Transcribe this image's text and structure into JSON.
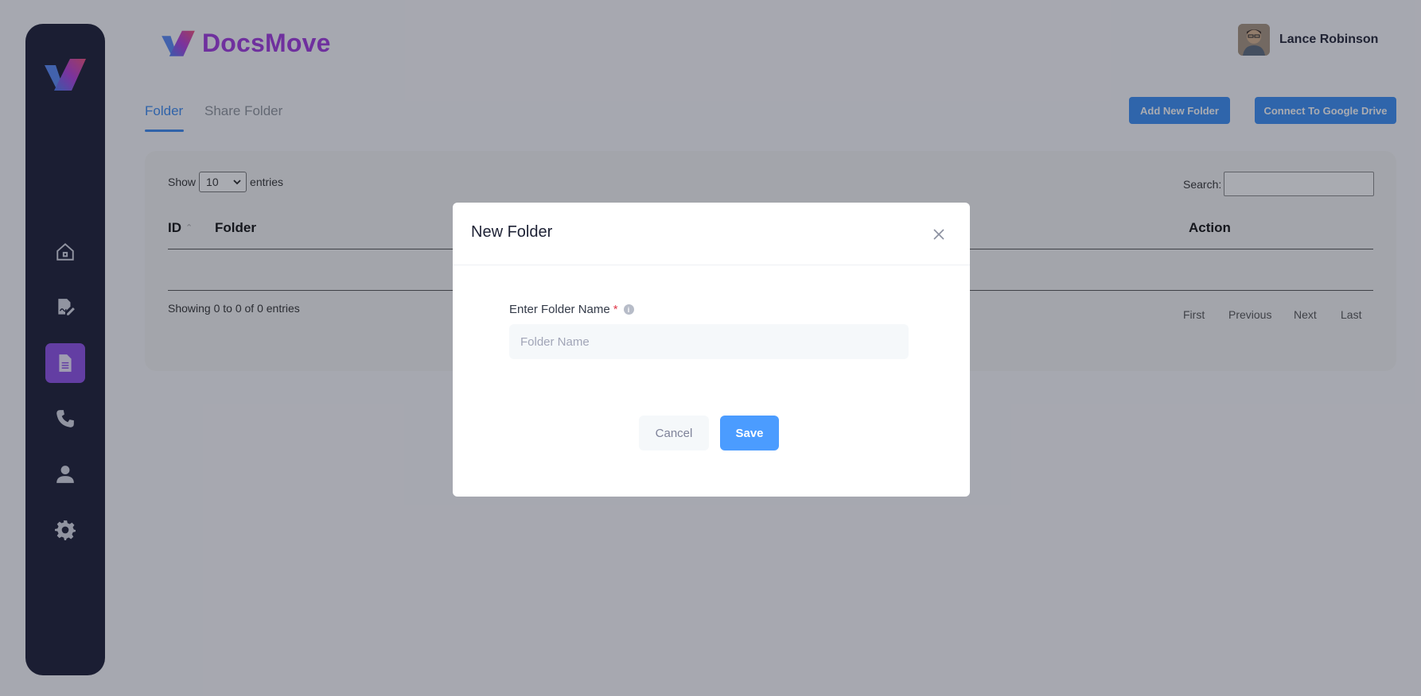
{
  "brand": {
    "name": "DocsMove"
  },
  "user": {
    "name": "Lance Robinson"
  },
  "sidebar": {
    "items": [
      {
        "icon": "home-icon"
      },
      {
        "icon": "signature-icon"
      },
      {
        "icon": "document-icon",
        "active": true
      },
      {
        "icon": "phone-icon"
      },
      {
        "icon": "user-icon"
      },
      {
        "icon": "gear-icon"
      }
    ]
  },
  "tabs": [
    {
      "label": "Folder",
      "active": true
    },
    {
      "label": "Share Folder"
    }
  ],
  "toolbar": {
    "add_label": "Add New Folder",
    "drive_label": "Connect To Google Drive"
  },
  "table": {
    "show_label": "Show",
    "entries_value": "10",
    "entries_label": "entries",
    "search_label": "Search:",
    "columns": [
      "ID",
      "Folder",
      "Action"
    ],
    "info": "Showing 0 to 0 of 0 entries",
    "pager": [
      "First",
      "Previous",
      "Next",
      "Last"
    ]
  },
  "modal": {
    "title": "New Folder",
    "field_label": "Enter Folder Name",
    "required_mark": "*",
    "placeholder": "Folder Name",
    "cancel_label": "Cancel",
    "save_label": "Save"
  },
  "colors": {
    "accent": "#3b8ef5",
    "brand": "#a239e0",
    "sidebar": "#1a1c34",
    "active_nav": "#8e4fe9"
  }
}
